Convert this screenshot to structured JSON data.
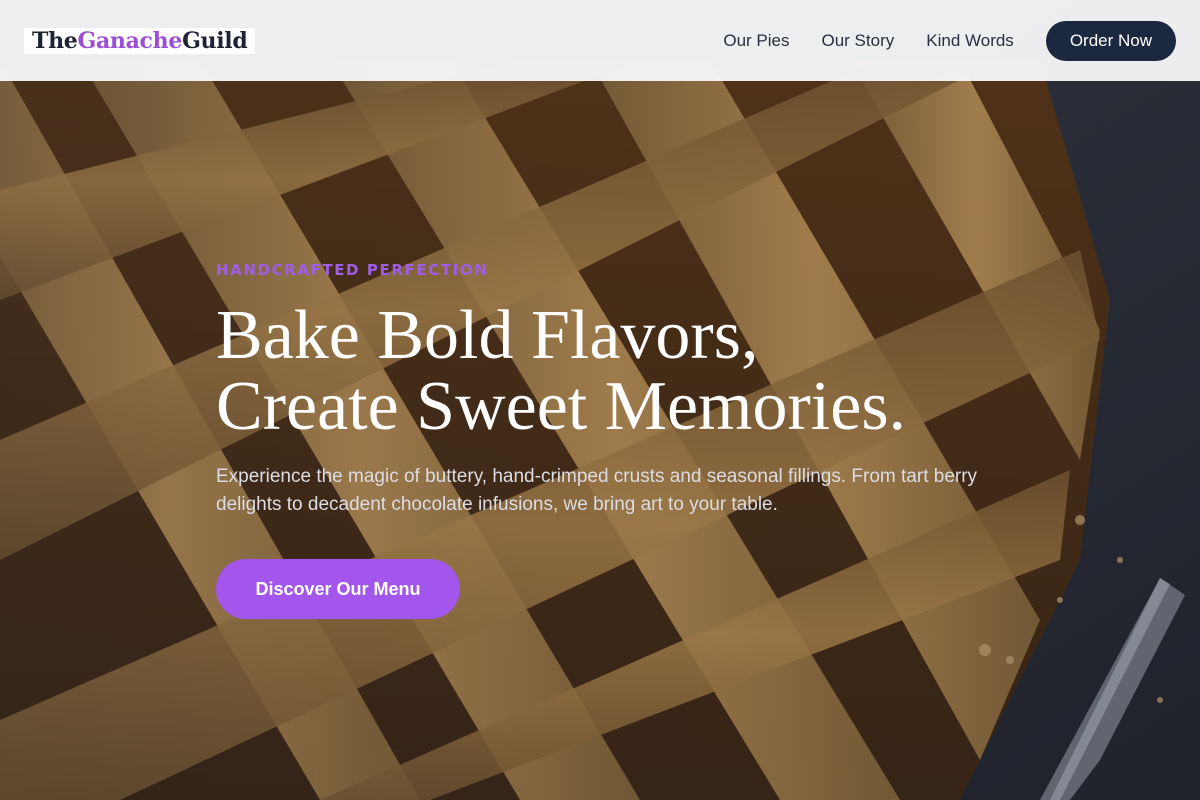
{
  "header": {
    "logo": {
      "part1": "The ",
      "part2": "Ganache",
      "part3": " Guild"
    },
    "nav": [
      "Our Pies",
      "Our Story",
      "Kind Words"
    ],
    "order_label": "Order Now"
  },
  "hero": {
    "eyebrow": "HANDCRAFTED PERFECTION",
    "headline_line1": "Bake Bold Flavors,",
    "headline_line2": "Create Sweet Memories.",
    "subtext": "Experience the magic of buttery, hand-crimped crusts and seasonal fillings. From tart berry delights to decadent chocolate infusions, we bring art to your table.",
    "cta_label": "Discover Our Menu"
  },
  "colors": {
    "accent": "#a356ec",
    "dark_navy": "#1c2740",
    "header_bg": "#f6f6f8"
  }
}
